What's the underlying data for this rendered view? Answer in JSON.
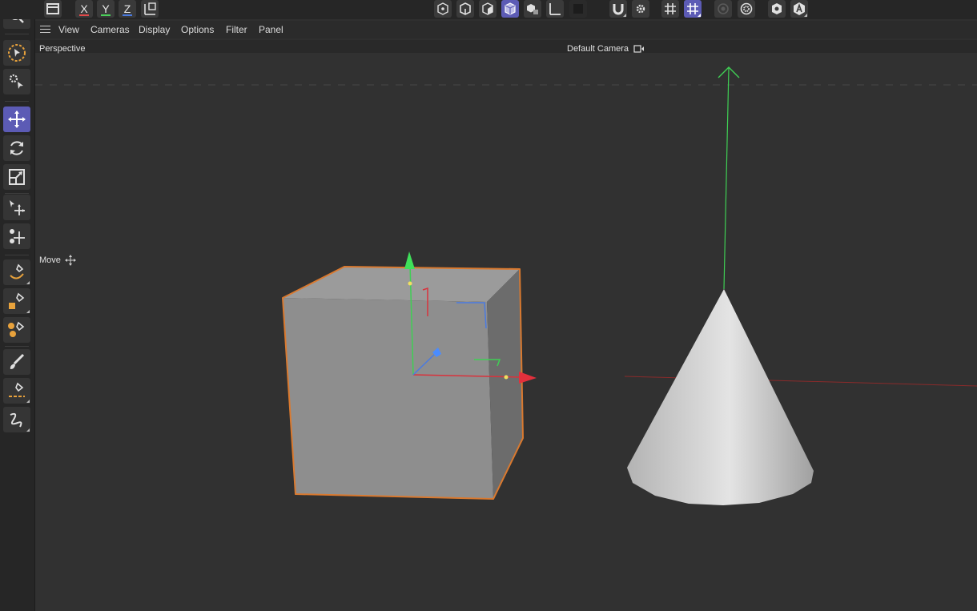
{
  "top_toolbar": {
    "axis_x": "X",
    "axis_y": "Y",
    "axis_z": "Z",
    "icons": [
      "panel-icon",
      "x-axis-lock",
      "y-axis-lock",
      "z-axis-lock",
      "coordinate-system-icon",
      "points-mode-icon",
      "edges-mode-icon",
      "polygons-mode-icon",
      "model-mode-icon",
      "texture-mode-icon",
      "axis-mode-icon",
      "solo-mode-icon",
      "snap-magnet-icon",
      "snap-settings-icon",
      "grid-icon",
      "workplane-grid-icon",
      "render-region-icon",
      "render-settings-icon",
      "viewport-solo-icon",
      "attribute-icon"
    ],
    "colors": {
      "x": "#e04a4a",
      "y": "#4ad05a",
      "z": "#4a7ae0",
      "active": "#5c5bb5"
    }
  },
  "left_toolbar": {
    "tools": [
      "search-icon",
      "live-selection-icon",
      "tweak-tool-icon",
      "move-tool-icon",
      "rotate-tool-icon",
      "scale-tool-icon",
      "transfer-tool-icon",
      "placement-tool-icon",
      "spline-pen-icon",
      "spline-sketch-icon",
      "spline-arc-icon",
      "brush-icon",
      "spline-line-icon",
      "spline-smooth-icon"
    ],
    "active": "move-tool-icon"
  },
  "menu": {
    "items": [
      "View",
      "Cameras",
      "Display",
      "Options",
      "Filter",
      "Panel"
    ]
  },
  "viewport": {
    "view_name": "Perspective",
    "camera_name": "Default Camera",
    "camera_icon": "camera-icon",
    "tool_hint": "Move",
    "tool_hint_icon": "move-cross-icon",
    "objects": [
      "cube",
      "cone"
    ],
    "selected_object": "cube",
    "selection_color": "#d9792f"
  }
}
